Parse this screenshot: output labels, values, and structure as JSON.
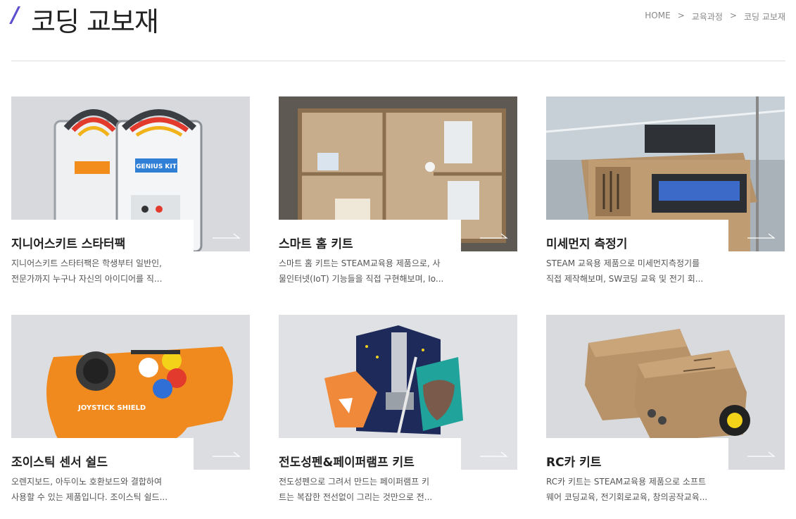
{
  "header": {
    "slash": "/",
    "title": "코딩 교보재",
    "breadcrumb": [
      "HOME",
      "교육과정",
      "코딩 교보재"
    ],
    "separator": ">"
  },
  "products": [
    {
      "title": "지니어스키트 스타터팩",
      "desc_line1": "지니어스키트 스타터팩은 학생부터 일반인,",
      "desc_line2": "전문가까지 누구나 자신의 아이디어를 직...",
      "image_text": "GENIUS KIT"
    },
    {
      "title": "스마트 홈 키트",
      "desc_line1": "스마트 홈 키트는 STEAM교육용 제품으로, 사",
      "desc_line2": "물인터넷(IoT) 기능들을 직접 구현해보며, Io..."
    },
    {
      "title": "미세먼지 측정기",
      "desc_line1": "STEAM 교육용 제품으로 미세먼지측정기를",
      "desc_line2": "직접 제작해보며, SW코딩 교육 및 전기 회..."
    },
    {
      "title": "조이스틱 센서 쉴드",
      "desc_line1": "오렌지보드, 아두이노 호환보드와 결합하여",
      "desc_line2": "사용할 수 있는 제품입니다. 조이스틱 쉴드...",
      "image_text": "JOYSTICK SHIELD"
    },
    {
      "title": "전도성펜&페이퍼램프 키트",
      "desc_line1": "전도성펜으로 그려서 만드는 페이퍼램프 키",
      "desc_line2": "트는 복잡한 전선없이 그리는 것만으로 전..."
    },
    {
      "title": "RC카 키트",
      "desc_line1": "RC카 키트는 STEAM교육용 제품으로 소프트",
      "desc_line2": "웨어 코딩교육, 전기회로교육, 창의공작교육..."
    }
  ],
  "colors": {
    "accent": "#5b4fd0",
    "divider": "#dcdcdc",
    "text": "#222222",
    "muted": "#555555"
  }
}
